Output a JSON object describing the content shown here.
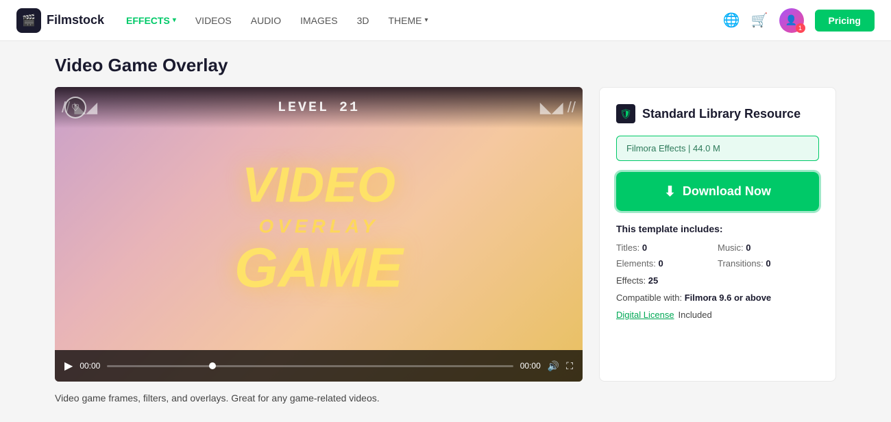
{
  "header": {
    "logo_text": "Filmstock",
    "nav_items": [
      {
        "label": "EFFECTS",
        "active": true,
        "has_dropdown": true
      },
      {
        "label": "VIDEOS",
        "active": false,
        "has_dropdown": false
      },
      {
        "label": "AUDIO",
        "active": false,
        "has_dropdown": false
      },
      {
        "label": "IMAGES",
        "active": false,
        "has_dropdown": false
      },
      {
        "label": "3D",
        "active": false,
        "has_dropdown": false
      },
      {
        "label": "THEME",
        "active": false,
        "has_dropdown": true
      }
    ],
    "pricing_label": "Pricing"
  },
  "page": {
    "title": "Video Game Overlay"
  },
  "video": {
    "level_text": "LEVEL 21",
    "overlay_video": "VIDEO",
    "overlay_subtitle": "OVERLAY",
    "overlay_game": "GAME",
    "time_start": "00:00",
    "time_end": "00:00"
  },
  "sidebar": {
    "library_badge": "Standard Library Resource",
    "file_label": "Filmora Effects | 44.0 M",
    "download_label": "Download Now",
    "includes_label": "This template includes:",
    "titles_label": "Titles:",
    "titles_value": "0",
    "music_label": "Music:",
    "music_value": "0",
    "elements_label": "Elements:",
    "elements_value": "0",
    "transitions_label": "Transitions:",
    "transitions_value": "0",
    "effects_label": "Effects:",
    "effects_value": "25",
    "compatible_label": "Compatible with:",
    "compatible_value": "Filmora 9.6 or above",
    "digital_license_link": "Digital License",
    "digital_license_suffix": "Included"
  },
  "description": {
    "text": "Video game frames, filters, and overlays. Great for any game-related videos."
  }
}
